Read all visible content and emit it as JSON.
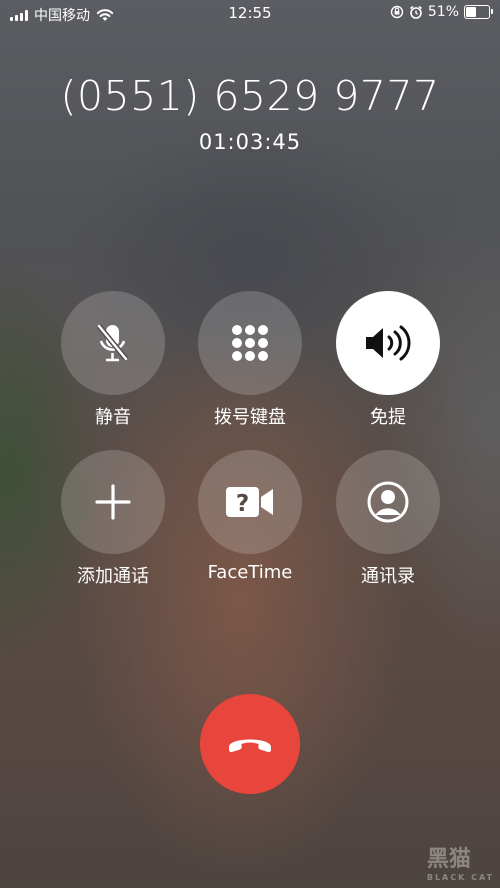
{
  "status": {
    "carrier": "中国移动",
    "time": "12:55",
    "battery": "51%",
    "battery_level": 0.51,
    "icons": [
      "signal-icon",
      "wifi-icon",
      "rotation-lock-icon",
      "alarm-icon",
      "battery-icon"
    ]
  },
  "call": {
    "number": "(0551) 6529 9777",
    "duration": "01:03:45"
  },
  "controls": {
    "mute": "静音",
    "keypad": "拨号键盘",
    "speaker": "免提",
    "add_call": "添加通话",
    "facetime": "FaceTime",
    "contacts": "通讯录"
  },
  "colors": {
    "end_call": "#e8463d",
    "speaker_active": "#ffffff"
  },
  "watermark": {
    "text": "黑猫",
    "sub": "BLACK CAT"
  }
}
